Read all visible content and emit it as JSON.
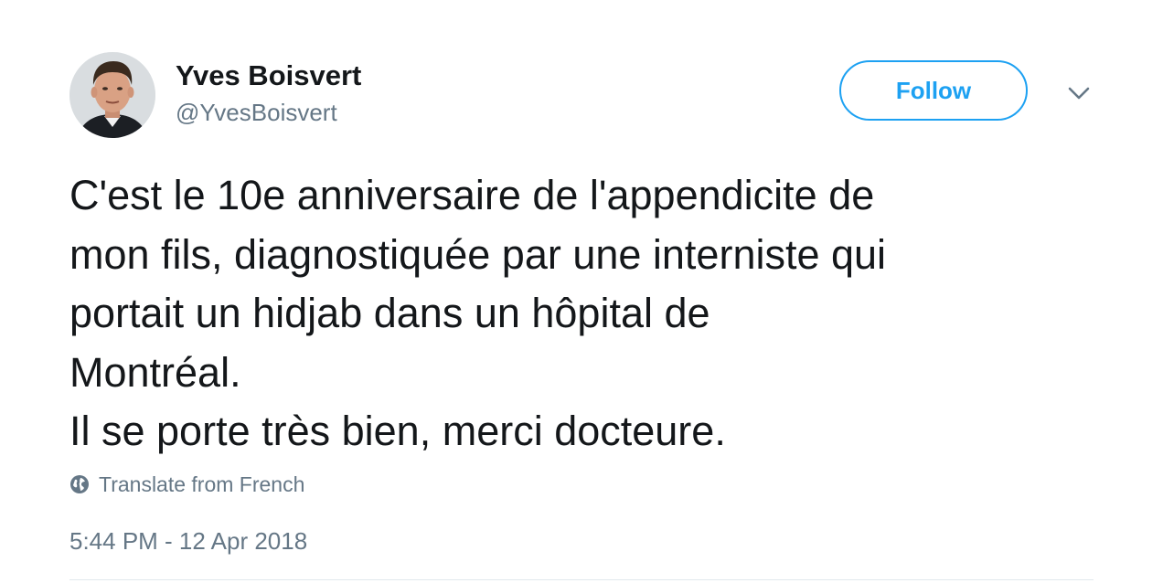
{
  "author": {
    "name": "Yves Boisvert",
    "handle": "@YvesBoisvert",
    "avatar_icon": "profile-photo"
  },
  "actions": {
    "follow_label": "Follow",
    "more_icon": "chevron-down-icon"
  },
  "tweet": {
    "lines": [
      "C'est le 10e anniversaire de l'appendicite de",
      "mon fils, diagnostiquée par une interniste qui",
      "portait un hidjab dans un hôpital de",
      "Montréal.",
      "Il se porte très bien, merci docteure."
    ],
    "translate_label": "Translate from French",
    "translate_icon": "globe-icon",
    "timestamp": "5:44 PM - 12 Apr 2018"
  },
  "colors": {
    "accent": "#1da1f2",
    "text": "#14171a",
    "secondary": "#657786",
    "divider": "#e1e8ed"
  }
}
